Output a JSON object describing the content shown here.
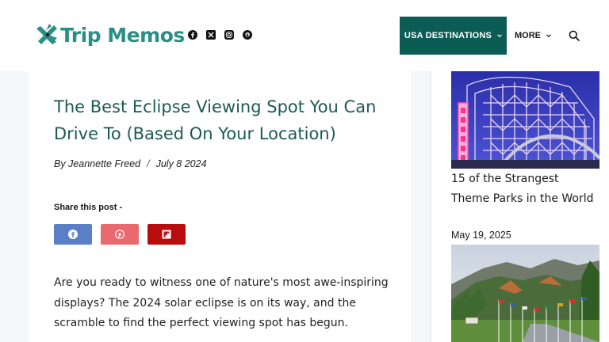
{
  "brand": {
    "name": "Trip Memos",
    "accent": "#2a8f86"
  },
  "social_icons": [
    "facebook-icon",
    "x-icon",
    "instagram-icon",
    "pinterest-icon"
  ],
  "nav": {
    "usa_label": "USA DESTINATIONS",
    "more_label": "MORE",
    "active_bg": "#0b5c55",
    "search_icon": "search-icon"
  },
  "article": {
    "title": "The Best Eclipse Viewing Spot You Can Drive To (Based On Your Location)",
    "author": "By Jeannette Freed",
    "separator": "/",
    "date": "July 8 2024",
    "share_label": "Share this post -",
    "share_buttons": [
      {
        "icon": "facebook-icon",
        "color": "#5b7fc4"
      },
      {
        "icon": "pinterest-icon",
        "color": "#e86a6e"
      },
      {
        "icon": "flipboard-icon",
        "color": "#b90d0d"
      }
    ],
    "intro": "Are you ready to witness one of nature's most awe-inspiring displays? The 2024 solar eclipse is on its way, and the scramble to find the perfect viewing spot has begun."
  },
  "sidebar": {
    "posts": [
      {
        "title": "15 of the Strangest Theme Parks in the World",
        "date": "May 19, 2025",
        "image": "roller-coaster-cyclone"
      },
      {
        "image": "mountain-flag-avenue"
      }
    ]
  }
}
